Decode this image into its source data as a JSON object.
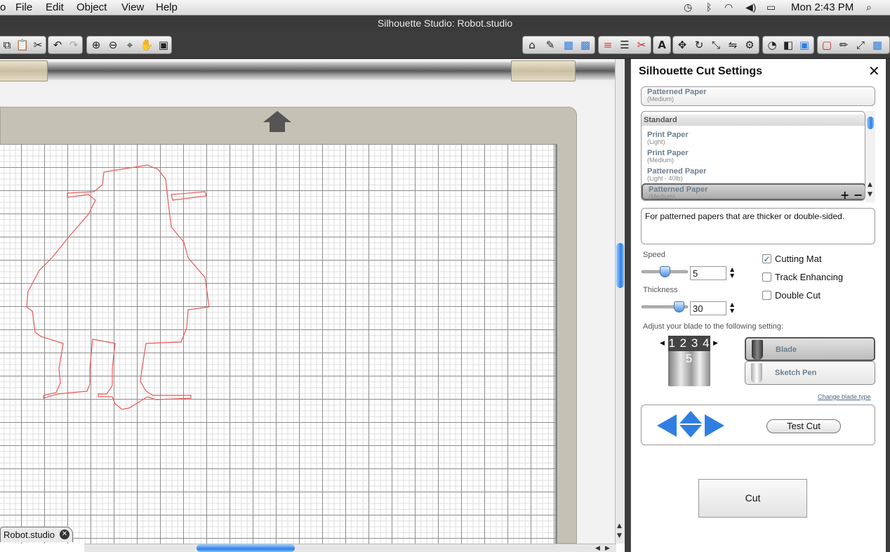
{
  "menubar": {
    "partial_app_menu": "o",
    "items": [
      "File",
      "Edit",
      "Object",
      "View",
      "Help"
    ],
    "clock": "Mon 2:43 PM"
  },
  "window": {
    "title": "Silhouette Studio: Robot.studio"
  },
  "document": {
    "tab_label": "Robot.studio",
    "tab_close": "✕"
  },
  "colors": {
    "cut_line": "#e85a5a",
    "accent_blue": "#2f7fe3",
    "mat": "#c4c2b5"
  },
  "panel": {
    "title": "Silhouette Cut Settings",
    "close": "✕",
    "selected_material": {
      "name": "Patterned Paper",
      "sub": "(Medium)"
    },
    "list_header": "Standard",
    "materials": [
      {
        "name": "Print Paper",
        "sub": "(Light)"
      },
      {
        "name": "Print Paper",
        "sub": "(Medium)"
      },
      {
        "name": "Patterned Paper",
        "sub": "(Light - 40lb)"
      },
      {
        "name": "Patterned Paper",
        "sub": "(Medium)"
      }
    ],
    "add": "+",
    "remove": "−",
    "description": "For patterned papers that are thicker or double-sided.",
    "speed": {
      "label": "Speed",
      "value": "5",
      "level": 0.5
    },
    "thickness": {
      "label": "Thickness",
      "value": "30",
      "level": 0.9
    },
    "checkboxes": [
      {
        "label": "Cutting Mat",
        "checked": true
      },
      {
        "label": "Track Enhancing",
        "checked": false
      },
      {
        "label": "Double Cut",
        "checked": false
      }
    ],
    "blade_prompt": "Adjust your blade to the following setting:",
    "blade_dial": "1 2 3 4 5",
    "tools": [
      {
        "label": "Blade",
        "selected": true
      },
      {
        "label": "Sketch Pen",
        "selected": false
      }
    ],
    "change_blade": "Change blade type",
    "test_cut": "Test Cut",
    "cut": "Cut"
  }
}
